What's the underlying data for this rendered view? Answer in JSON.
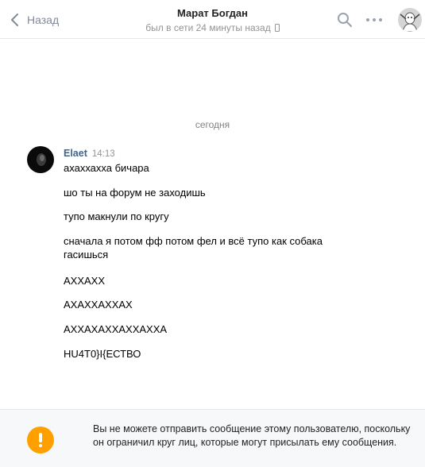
{
  "header": {
    "back_label": "Назад",
    "title": "Марат Богдан",
    "status": "был в сети 24 минуты назад"
  },
  "chat": {
    "date_separator": "сегодня",
    "message": {
      "author": "Elaet",
      "time": "14:13",
      "lines": [
        "ахаххахха бичара",
        "шо ты на форум не заходишь",
        "тупо макнули по кругу",
        "сначала я потом фф потом фел и всё тупо как собака гасишься",
        "АХХАХХ",
        "АХАХХАХХАХ",
        "АХХАХАХХАХХАХХА",
        "HU4T0}I{ЕСТВО"
      ]
    }
  },
  "notice": {
    "text": "Вы не можете отправить сообщение этому пользователю, поскольку он ограничил круг лиц, которые могут присылать ему сообщения."
  },
  "colors": {
    "link": "#42648b",
    "muted": "#939393",
    "warning": "#ffa000",
    "divider": "#e7e8ec"
  },
  "icons": {
    "back": "chevron-left-icon",
    "search": "search-icon",
    "more": "more-dots-icon",
    "status_device": "mobile-phone-icon",
    "warning": "exclamation-circle-icon"
  }
}
